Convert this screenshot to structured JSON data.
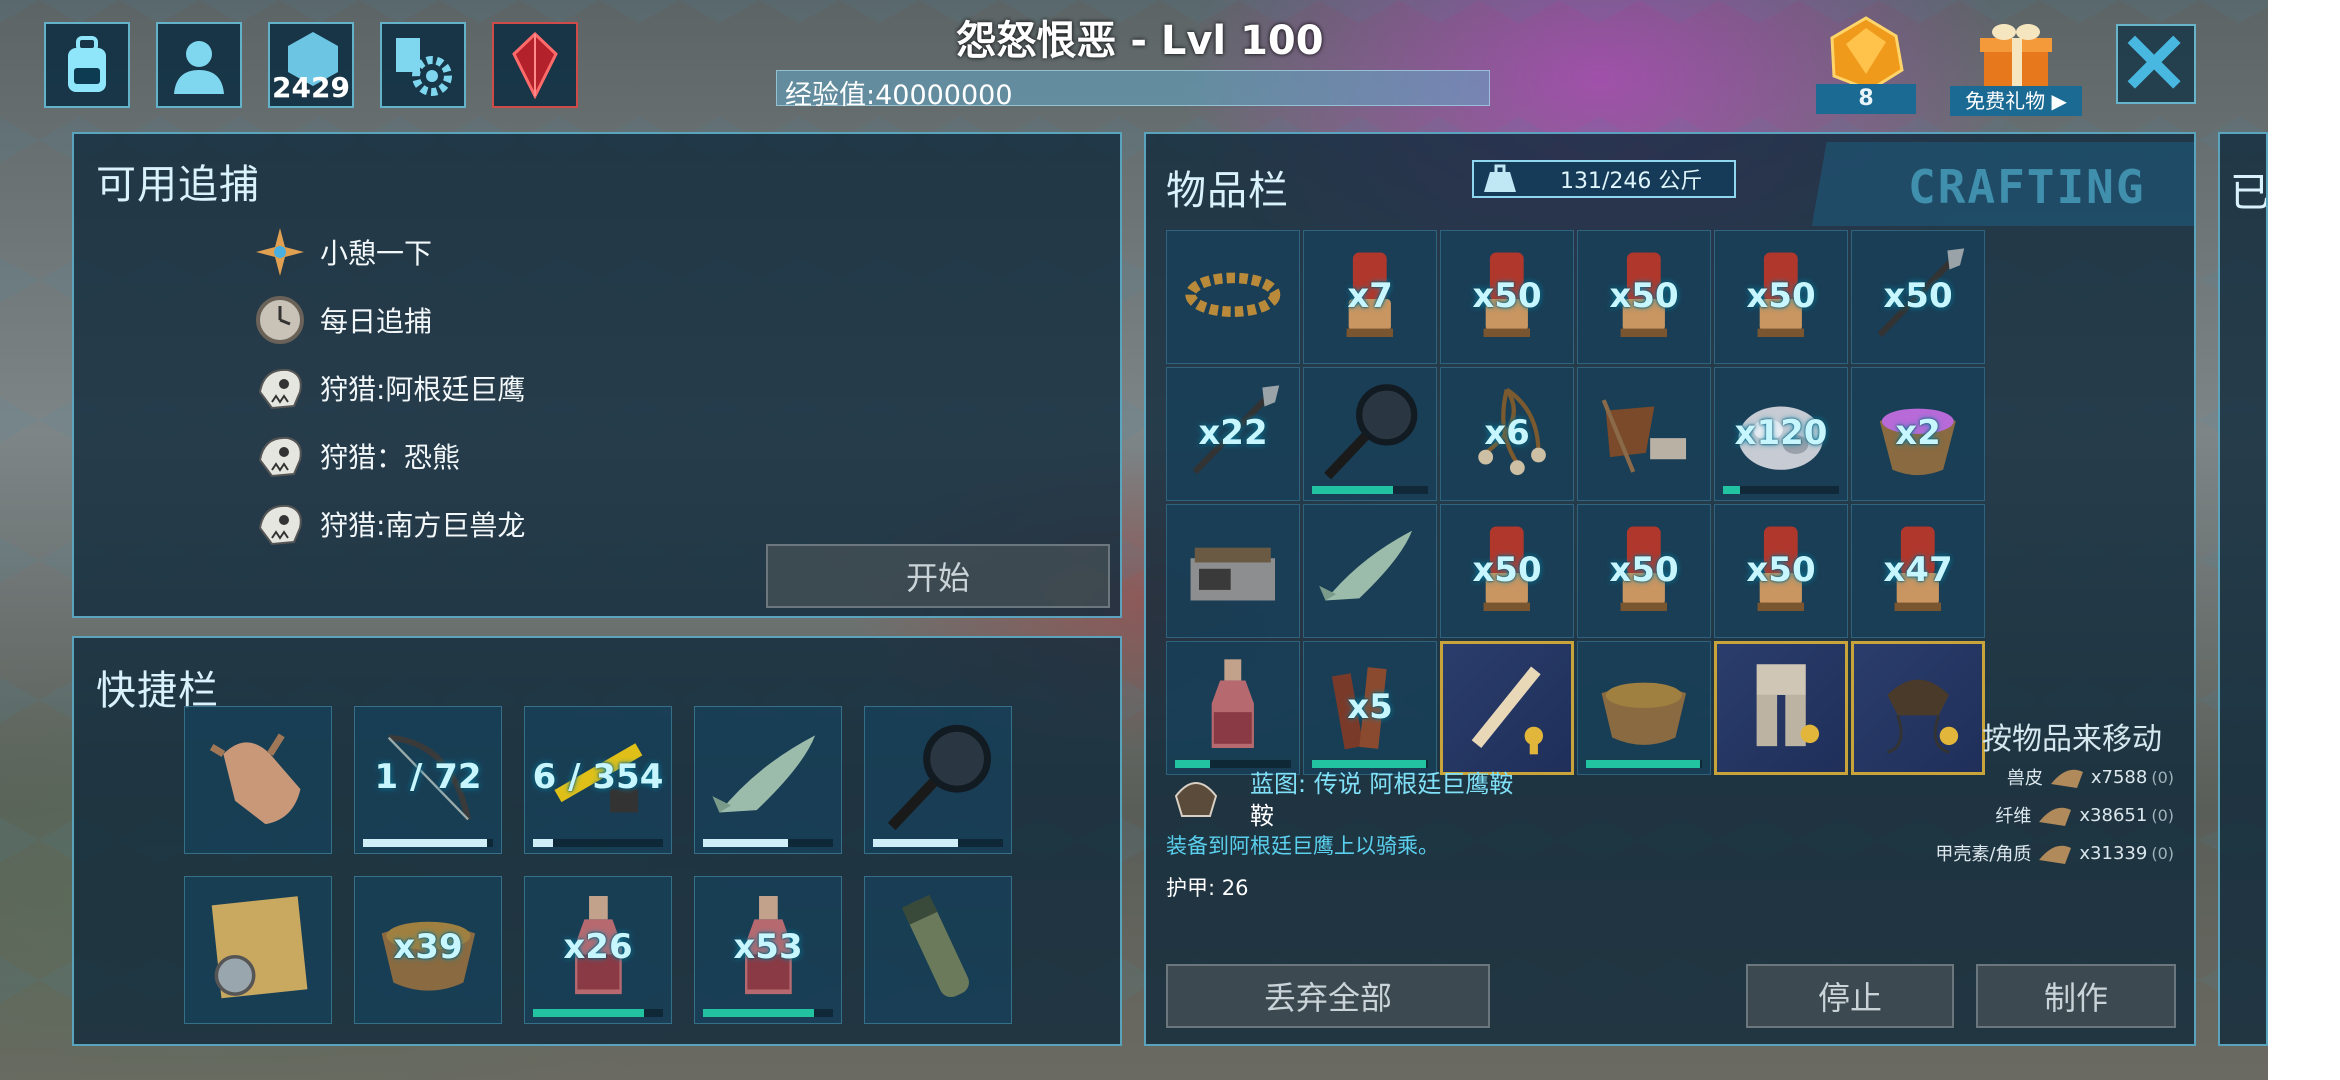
{
  "header": {
    "player_title": "怨怒恨恶 - Lvl 100",
    "xp_label": "经验值:40000000",
    "engram_points": "2429",
    "gem_count": "8",
    "free_gift_label": "免费礼物 ▶"
  },
  "top_buttons": [
    "inventory-icon",
    "character-icon",
    "engram-icon",
    "settings-icon",
    "tribe-crystal-icon"
  ],
  "hunts": {
    "title": "可用追捕",
    "items": [
      {
        "label": "小憩一下",
        "icon": "star-compass-icon"
      },
      {
        "label": "每日追捕",
        "icon": "clock-medal-icon"
      },
      {
        "label": "狩猎:阿根廷巨鹰",
        "icon": "skull-icon"
      },
      {
        "label": "狩猎：恐熊",
        "icon": "skull-icon"
      },
      {
        "label": "狩猎:南方巨兽龙",
        "icon": "skull-icon"
      }
    ],
    "start_button": "开始"
  },
  "hotbar": {
    "title": "快捷栏",
    "slots": [
      {
        "icon": "hand-icon",
        "text": "",
        "dur": 0
      },
      {
        "icon": "bow-icon",
        "text": "1 / 72",
        "dur": 0.95
      },
      {
        "icon": "rifle-icon",
        "text": "6 / 354",
        "dur": 0.15
      },
      {
        "icon": "fish-icon",
        "text": "",
        "dur": 0.65
      },
      {
        "icon": "frying-pan-icon",
        "text": "",
        "dur": 0.65
      },
      {
        "icon": "treasure-map-icon",
        "text": "",
        "dur": 0
      },
      {
        "icon": "bowl-icon",
        "text": "x39",
        "dur": 0
      },
      {
        "icon": "bottle-icon",
        "text": "x26",
        "dur": 0.85
      },
      {
        "icon": "bottle-icon",
        "text": "x53",
        "dur": 0.85
      },
      {
        "icon": "spyglass-icon",
        "text": "",
        "dur": 0
      }
    ]
  },
  "inventory": {
    "title": "物品栏",
    "weight": "131/246 公斤",
    "crafting_tab": "CRAFTING",
    "drag_hint": "按物品来移动",
    "slots": [
      {
        "icon": "chain-icon",
        "text": "",
        "dur": 0,
        "gold": false
      },
      {
        "icon": "ammo-icon",
        "text": "x7",
        "dur": 0,
        "gold": false
      },
      {
        "icon": "ammo-icon",
        "text": "x50",
        "dur": 0,
        "gold": false
      },
      {
        "icon": "ammo-icon",
        "text": "x50",
        "dur": 0,
        "gold": false
      },
      {
        "icon": "ammo-icon",
        "text": "x50",
        "dur": 0,
        "gold": false
      },
      {
        "icon": "spear-icon",
        "text": "x50",
        "dur": 0,
        "gold": false
      },
      {
        "icon": "spear-icon",
        "text": "x22",
        "dur": 0,
        "gold": false
      },
      {
        "icon": "frying-pan-icon",
        "text": "",
        "dur": 0.7,
        "gold": false
      },
      {
        "icon": "bola-icon",
        "text": "x6",
        "dur": 0,
        "gold": false
      },
      {
        "icon": "tanning-rack-icon",
        "text": "",
        "dur": 0,
        "gold": false
      },
      {
        "icon": "ore-icon",
        "text": "x120",
        "dur": 0.15,
        "gold": false
      },
      {
        "icon": "crystal-bowl-icon",
        "text": "x2",
        "dur": 0,
        "gold": false
      },
      {
        "icon": "cooking-station-icon",
        "text": "",
        "dur": 0,
        "gold": false
      },
      {
        "icon": "fish-icon",
        "text": "",
        "dur": 0,
        "gold": false
      },
      {
        "icon": "ammo-icon",
        "text": "x50",
        "dur": 0,
        "gold": false
      },
      {
        "icon": "ammo-icon",
        "text": "x50",
        "dur": 0,
        "gold": false
      },
      {
        "icon": "ammo-icon",
        "text": "x50",
        "dur": 0,
        "gold": false
      },
      {
        "icon": "ammo-icon",
        "text": "x47",
        "dur": 0,
        "gold": false
      },
      {
        "icon": "bottle-icon",
        "text": "",
        "dur": 0.3,
        "gold": false
      },
      {
        "icon": "wood-icon",
        "text": "x5",
        "dur": 0.98,
        "gold": false
      },
      {
        "icon": "club-blueprint-icon",
        "text": "",
        "dur": 0,
        "gold": true
      },
      {
        "icon": "bowl-icon",
        "text": "",
        "dur": 0.98,
        "gold": false
      },
      {
        "icon": "armor-blueprint-icon",
        "text": "",
        "dur": 0,
        "gold": true
      },
      {
        "icon": "saddle-blueprint-icon",
        "text": "",
        "dur": 0,
        "gold": true
      }
    ]
  },
  "detail": {
    "name": "蓝图: 传说 阿根廷巨鹰鞍",
    "type": "鞍",
    "description": "装备到阿根廷巨鹰上以骑乘。",
    "armor_label": "护甲:",
    "armor_value": "26",
    "resources": [
      {
        "name": "兽皮",
        "amount": "x7588",
        "extra": "(0)"
      },
      {
        "name": "纤维",
        "amount": "x38651",
        "extra": "(0)"
      },
      {
        "name": "甲壳素/角质",
        "amount": "x31339",
        "extra": "(0)"
      }
    ]
  },
  "buttons": {
    "drop_all": "丢弃全部",
    "stop": "停止",
    "craft": "制作"
  },
  "right_panel_title": "已",
  "colors": {
    "accent": "#6fd0ea",
    "gold": "#c9a43a",
    "durability": "#21c3a0"
  }
}
